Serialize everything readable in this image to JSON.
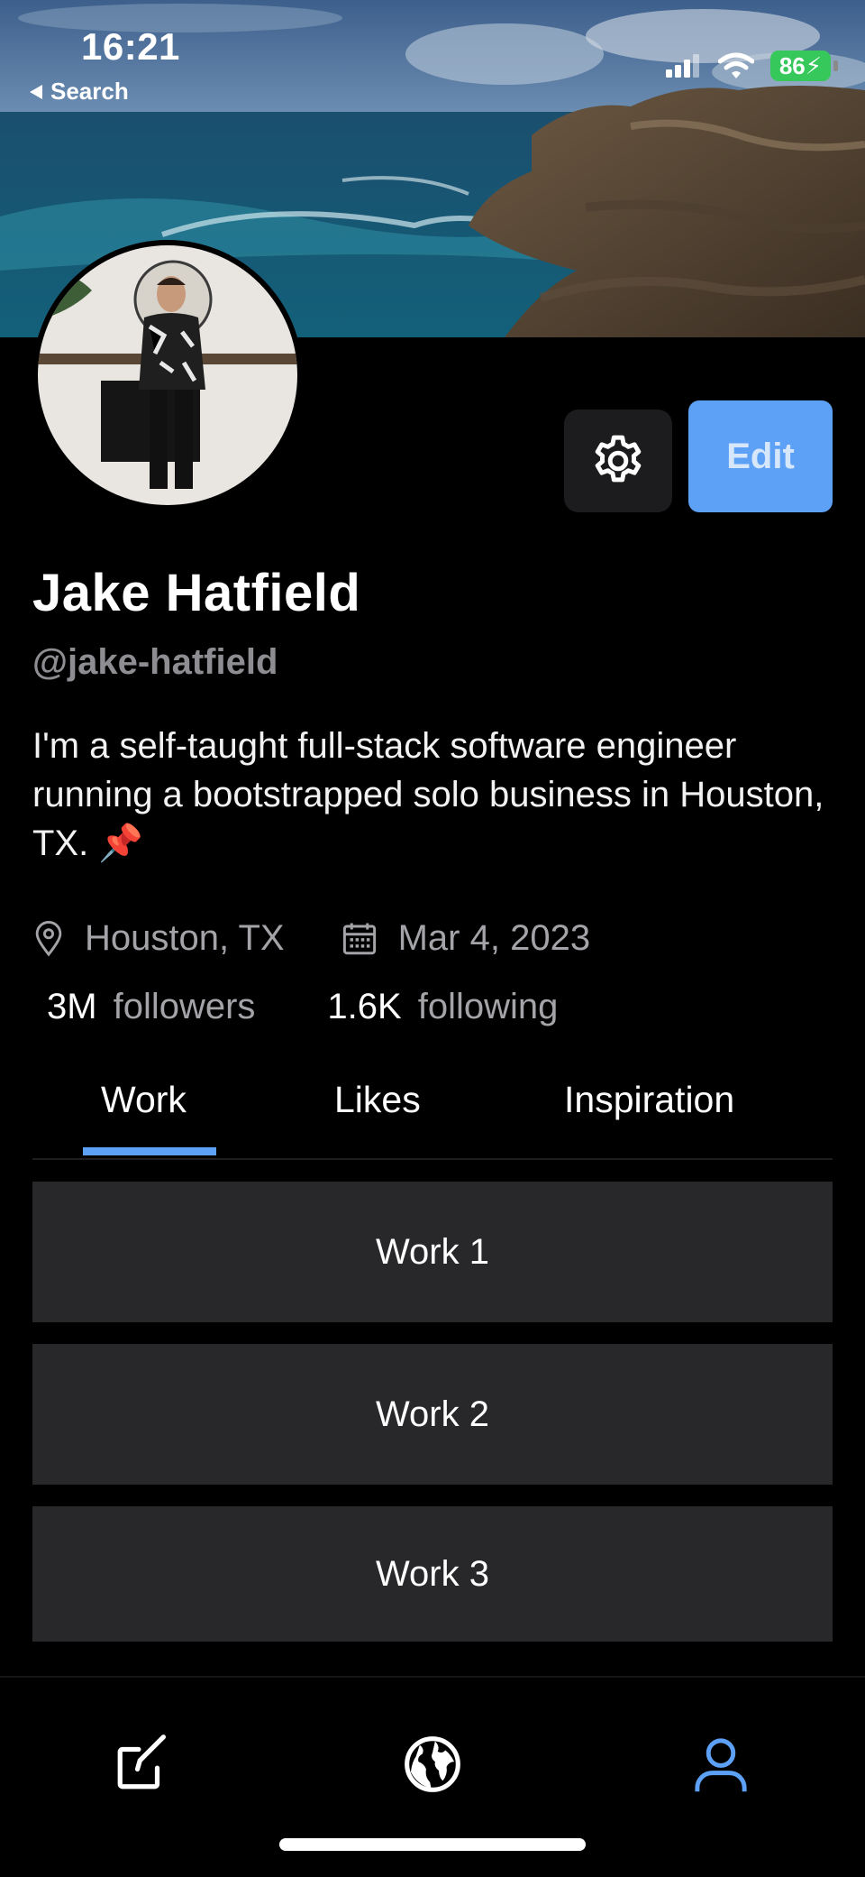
{
  "status_bar": {
    "time": "16:21",
    "back_label": "Search",
    "battery": "86"
  },
  "profile": {
    "name": "Jake Hatfield",
    "handle": "@jake-hatfield",
    "bio": "I'm a self-taught full-stack software engineer running a bootstrapped solo business in Houston, TX. 📌",
    "location": "Houston, TX",
    "joined": "Mar 4, 2023",
    "followers_count": "3M",
    "followers_label": "followers",
    "following_count": "1.6K",
    "following_label": "following"
  },
  "actions": {
    "edit_label": "Edit"
  },
  "tabs": [
    {
      "label": "Work",
      "active": true
    },
    {
      "label": "Likes",
      "active": false
    },
    {
      "label": "Inspiration",
      "active": false
    }
  ],
  "work_items": [
    "Work 1",
    "Work 2",
    "Work 3"
  ],
  "bottom_nav": [
    {
      "icon": "compose-icon",
      "active": false
    },
    {
      "icon": "globe-icon",
      "active": false
    },
    {
      "icon": "profile-icon",
      "active": true
    }
  ],
  "colors": {
    "accent": "#5da1f7",
    "background": "#000000",
    "card": "#28282a",
    "muted_text": "#a3a3a8",
    "battery": "#36c85a"
  }
}
